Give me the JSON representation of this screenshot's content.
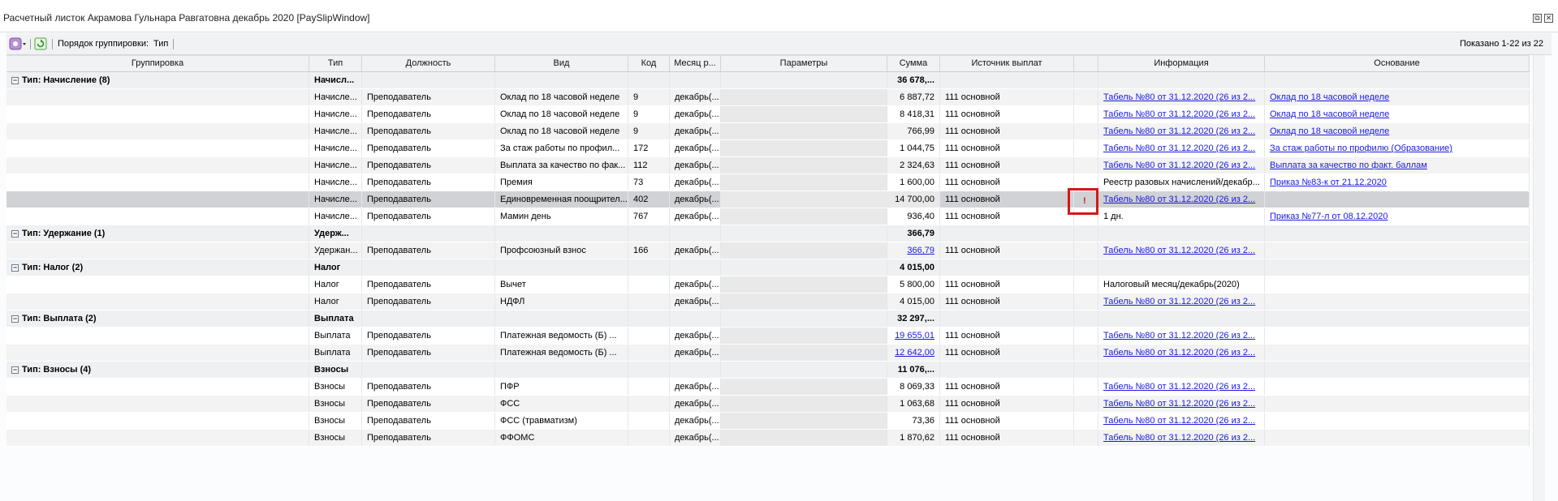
{
  "window": {
    "title": "Расчетный листок Акрамова Гульнара Равгатовна декабрь 2020 [PaySlipWindow]",
    "restore_symbol": "⧉",
    "close_symbol": "✕"
  },
  "toolbar": {
    "menu_icon": "gear-icon",
    "refresh_icon": "refresh-icon",
    "grouping_label": "Порядок группировки:",
    "grouping_value": "Тип",
    "shown_text": "Показано 1-22 из 22"
  },
  "columns": [
    "Группировка",
    "Тип",
    "Должность",
    "Вид",
    "Код",
    "Месяц р...",
    "Параметры",
    "Сумма",
    "Источник выплат",
    "",
    "Информация",
    "Основание"
  ],
  "rows": [
    {
      "kind": "group",
      "group": "Тип: Начисление (8)",
      "type": "Начисл...",
      "sum": "36 678,..."
    },
    {
      "kind": "data",
      "type": "Начисле...",
      "position": "Преподаватель",
      "view": "Оклад по 18 часовой неделе",
      "code": "9",
      "month": "декабрь(...",
      "sum": "6 887,72",
      "source": "111 основной",
      "info": "Табель №80 от 31.12.2020 (26 из 2...",
      "basis": "Оклад по 18 часовой неделе"
    },
    {
      "kind": "data",
      "type": "Начисле...",
      "position": "Преподаватель",
      "view": "Оклад по 18 часовой неделе",
      "code": "9",
      "month": "декабрь(...",
      "sum": "8 418,31",
      "source": "111 основной",
      "info": "Табель №80 от 31.12.2020 (26 из 2...",
      "basis": "Оклад по 18 часовой неделе"
    },
    {
      "kind": "data",
      "type": "Начисле...",
      "position": "Преподаватель",
      "view": "Оклад по 18 часовой неделе",
      "code": "9",
      "month": "декабрь(...",
      "sum": "766,99",
      "source": "111 основной",
      "info": "Табель №80 от 31.12.2020 (26 из 2...",
      "basis": "Оклад по 18 часовой неделе"
    },
    {
      "kind": "data",
      "type": "Начисле...",
      "position": "Преподаватель",
      "view": "За стаж работы по профил...",
      "code": "172",
      "month": "декабрь(...",
      "sum": "1 044,75",
      "source": "111 основной",
      "info": "Табель №80 от 31.12.2020 (26 из 2...",
      "basis": "За стаж работы по профилю (Образование)"
    },
    {
      "kind": "data",
      "type": "Начисле...",
      "position": "Преподаватель",
      "view": "Выплата за качество по фак...",
      "code": "112",
      "month": "декабрь(...",
      "sum": "2 324,63",
      "source": "111 основной",
      "info": "Табель №80 от 31.12.2020 (26 из 2...",
      "basis": "Выплата за качество по факт. баллам"
    },
    {
      "kind": "data",
      "type": "Начисле...",
      "position": "Преподаватель",
      "view": "Премия",
      "code": "73",
      "month": "декабрь(...",
      "sum": "1 600,00",
      "source": "111 основной",
      "info_plain": "Реестр разовых начислений/декабр...",
      "basis": "Приказ №83-к от 21.12.2020"
    },
    {
      "kind": "data",
      "selected": true,
      "flag": "!",
      "type": "Начисле...",
      "position": "Преподаватель",
      "view": "Единовременная поощрител...",
      "code": "402",
      "month": "декабрь(...",
      "sum": "14 700,00",
      "source": "111 основной",
      "info": "Табель №80 от 31.12.2020 (26 из 2..."
    },
    {
      "kind": "data",
      "type": "Начисле...",
      "position": "Преподаватель",
      "view": "Мамин день",
      "code": "767",
      "month": "декабрь(...",
      "sum": "936,40",
      "source": "111 основной",
      "info_plain": "1 дн.",
      "basis": "Приказ №77-л от 08.12.2020"
    },
    {
      "kind": "group",
      "group": "Тип: Удержание (1)",
      "type": "Удерж...",
      "sum": "366,79"
    },
    {
      "kind": "data",
      "type": "Удержан...",
      "position": "Преподаватель",
      "view": "Профсоюзный взнос",
      "code": "166",
      "month": "декабрь(...",
      "sum_link": "366,79",
      "source": "111 основной",
      "info": "Табель №80 от 31.12.2020 (26 из 2..."
    },
    {
      "kind": "group",
      "group": "Тип: Налог (2)",
      "type": "Налог",
      "sum": "4 015,00"
    },
    {
      "kind": "data",
      "type": "Налог",
      "position": "Преподаватель",
      "view": "Вычет",
      "code": "",
      "month": "декабрь(...",
      "sum": "5 800,00",
      "source": "111 основной",
      "info_plain": "Налоговый месяц/декабрь(2020)"
    },
    {
      "kind": "data",
      "type": "Налог",
      "position": "Преподаватель",
      "view": "НДФЛ",
      "code": "",
      "month": "декабрь(...",
      "sum": "4 015,00",
      "source": "111 основной",
      "info": "Табель №80 от 31.12.2020 (26 из 2..."
    },
    {
      "kind": "group",
      "group": "Тип: Выплата (2)",
      "type": "Выплата",
      "sum": "32 297,..."
    },
    {
      "kind": "data",
      "type": "Выплата",
      "position": "Преподаватель",
      "view": "Платежная ведомость (Б) ...",
      "code": "",
      "month": "декабрь(...",
      "sum_link": "19 655,01",
      "source": "111 основной",
      "info": "Табель №80 от 31.12.2020 (26 из 2..."
    },
    {
      "kind": "data",
      "type": "Выплата",
      "position": "Преподаватель",
      "view": "Платежная ведомость (Б) ...",
      "code": "",
      "month": "декабрь(...",
      "sum_link": "12 642,00",
      "source": "111 основной",
      "info": "Табель №80 от 31.12.2020 (26 из 2..."
    },
    {
      "kind": "group",
      "group": "Тип: Взносы (4)",
      "type": "Взносы",
      "sum": "11 076,..."
    },
    {
      "kind": "data",
      "type": "Взносы",
      "position": "Преподаватель",
      "view": "ПФР",
      "code": "",
      "month": "декабрь(...",
      "sum": "8 069,33",
      "source": "111 основной",
      "info": "Табель №80 от 31.12.2020 (26 из 2..."
    },
    {
      "kind": "data",
      "type": "Взносы",
      "position": "Преподаватель",
      "view": "ФСС",
      "code": "",
      "month": "декабрь(...",
      "sum": "1 063,68",
      "source": "111 основной",
      "info": "Табель №80 от 31.12.2020 (26 из 2..."
    },
    {
      "kind": "data",
      "type": "Взносы",
      "position": "Преподаватель",
      "view": "ФСС (травматизм)",
      "code": "",
      "month": "декабрь(...",
      "sum": "73,36",
      "source": "111 основной",
      "info": "Табель №80 от 31.12.2020 (26 из 2..."
    },
    {
      "kind": "data",
      "type": "Взносы",
      "position": "Преподаватель",
      "view": "ФФОМС",
      "code": "",
      "month": "декабрь(...",
      "sum": "1 870,62",
      "source": "111 основной",
      "info": "Табель №80 от 31.12.2020 (26 из 2..."
    }
  ]
}
